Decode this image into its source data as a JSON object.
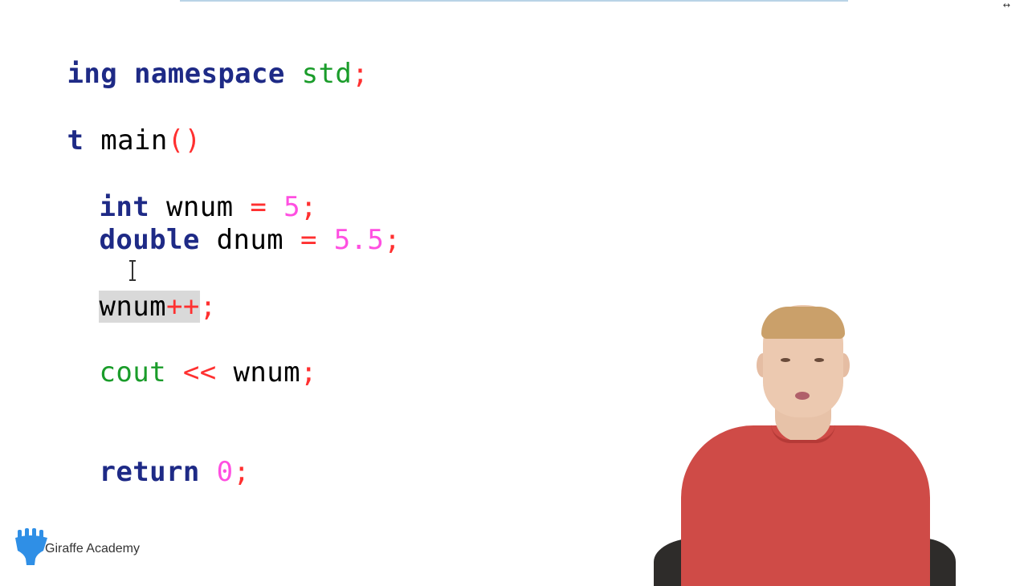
{
  "code": {
    "line1": [
      "ing",
      "namespace",
      "std",
      ";"
    ],
    "line2": [
      "t",
      "main",
      "()"
    ],
    "line3": [
      "int",
      "wnum",
      "=",
      "5",
      ";"
    ],
    "line4": [
      "double",
      "dnum",
      "=",
      "5.5",
      ";"
    ],
    "line5": [
      "wnum",
      "++",
      ";"
    ],
    "line6": [
      "cout",
      "<<",
      "wnum",
      ";"
    ],
    "line7": [
      "return",
      "0",
      ";"
    ]
  },
  "branding": {
    "logo_text": "Giraffe Academy"
  },
  "colors": {
    "keyword": "#1e2a86",
    "operator": "#ff3030",
    "number": "#ff4fe1",
    "library": "#1a9c2a",
    "selection": "#d9d9d9",
    "logo": "#2f8fe6"
  }
}
